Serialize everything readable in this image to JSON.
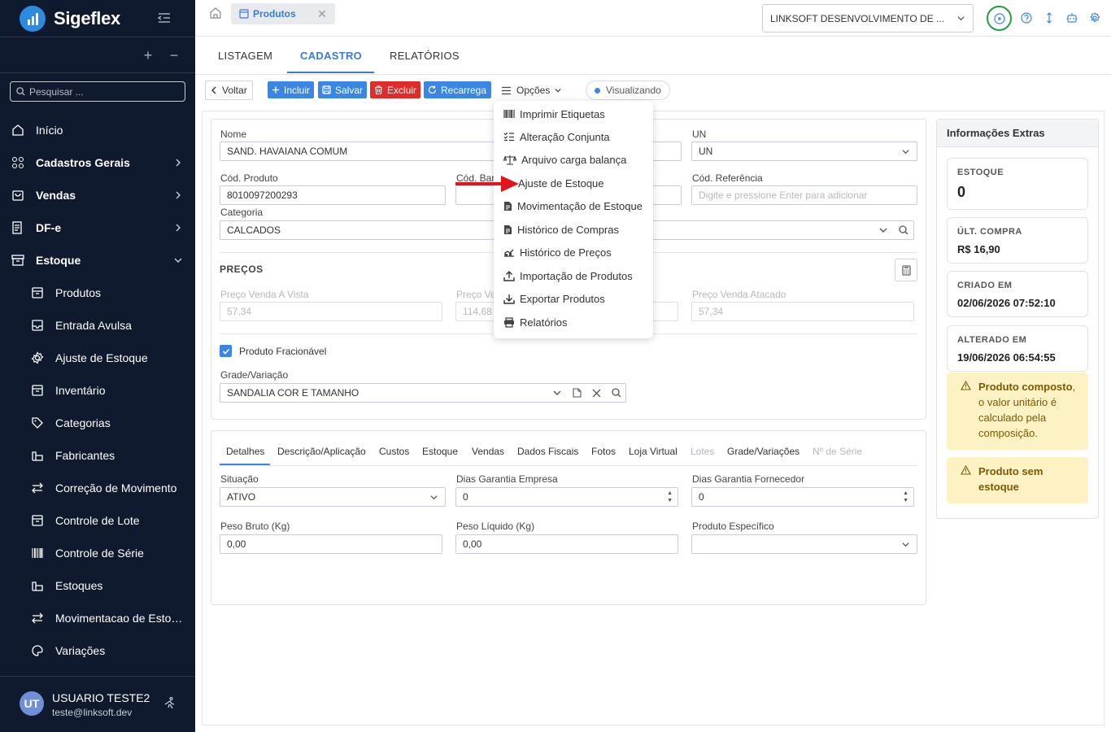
{
  "app": {
    "name": "Sigeflex"
  },
  "sidebar": {
    "search_placeholder": "Pesquisar ...",
    "items": [
      {
        "label": "Início",
        "icon": "home-icon"
      },
      {
        "label": "Cadastros Gerais",
        "icon": "grid-icon"
      },
      {
        "label": "Vendas",
        "icon": "shopping-bag-icon"
      },
      {
        "label": "DF-e",
        "icon": "document-icon"
      },
      {
        "label": "Estoque",
        "icon": "inventory-box-icon"
      }
    ],
    "sub_items": [
      {
        "label": "Produtos",
        "icon": "box-icon"
      },
      {
        "label": "Entrada Avulsa",
        "icon": "inbox-icon"
      },
      {
        "label": "Ajuste de Estoque",
        "icon": "gear-icon"
      },
      {
        "label": "Inventário",
        "icon": "box-icon"
      },
      {
        "label": "Categorias",
        "icon": "tag-icon"
      },
      {
        "label": "Fabricantes",
        "icon": "factory-icon"
      },
      {
        "label": "Correção de Movimento",
        "icon": "swap-icon"
      },
      {
        "label": "Controle de Lote",
        "icon": "box-icon"
      },
      {
        "label": "Controle de Série",
        "icon": "barcode-icon"
      },
      {
        "label": "Estoques",
        "icon": "factory-icon"
      },
      {
        "label": "Movimentacao de Estoque",
        "icon": "swap-icon"
      },
      {
        "label": "Variações",
        "icon": "palette-icon"
      }
    ],
    "user": {
      "initials": "UT",
      "name": "USUARIO TESTE2",
      "email": "teste@linksoft.dev"
    }
  },
  "topbar": {
    "tab_label": "Produtos",
    "company": "LINKSOFT DESENVOLVIMENTO DE ..."
  },
  "subtabs": [
    "LISTAGEM",
    "CADASTRO",
    "RELATÓRIOS"
  ],
  "toolbar": {
    "voltar": "Voltar",
    "incluir": "Incluir",
    "salvar": "Salvar",
    "excluir": "Excluir",
    "recarrega": "Recarrega",
    "opcoes": "Opções",
    "status": "Visualizando"
  },
  "form": {
    "nome_label": "Nome",
    "nome_value": "SAND. HAVAIANA COMUM",
    "un_label": "UN",
    "un_value": "UN",
    "cod_produto_label": "Cód. Produto",
    "cod_produto_value": "8010097200293",
    "cod_barras_label": "Cód. Bar",
    "cod_ref_label": "Cód. Referência",
    "cod_ref_placeholder": "Digite e pressione Enter para adicionar",
    "categoria_label": "Categoria",
    "categoria_value": "CALCADOS",
    "precos_title": "PREÇOS",
    "preco_vista_label": "Preço Venda A Vista",
    "preco_vista_value": "57,34",
    "preco_ve_label": "Preço Ve",
    "preco_ve_value": "114,68",
    "preco_atacado_label": "Preço Venda Atacado",
    "preco_atacado_value": "57,34",
    "fracionavel_label": "Produto Fracionável",
    "fracionavel_checked": true,
    "grade_label": "Grade/Variação",
    "grade_value": "SANDALIA COR E TAMANHO"
  },
  "details": {
    "tabs": [
      {
        "label": "Detalhes",
        "disabled": false
      },
      {
        "label": "Descrição/Aplicação",
        "disabled": false
      },
      {
        "label": "Custos",
        "disabled": false
      },
      {
        "label": "Estoque",
        "disabled": false
      },
      {
        "label": "Vendas",
        "disabled": false
      },
      {
        "label": "Dados Fiscais",
        "disabled": false
      },
      {
        "label": "Fotos",
        "disabled": false
      },
      {
        "label": "Loja Virtual",
        "disabled": false
      },
      {
        "label": "Lotes",
        "disabled": true
      },
      {
        "label": "Grade/Variações",
        "disabled": false
      },
      {
        "label": "Nº de Série",
        "disabled": true
      }
    ],
    "situacao_label": "Situação",
    "situacao_value": "ATIVO",
    "garantia_empresa_label": "Dias Garantia Empresa",
    "garantia_empresa_value": "0",
    "garantia_fornecedor_label": "Dias Garantia Fornecedor",
    "garantia_fornecedor_value": "0",
    "peso_bruto_label": "Peso Bruto (Kg)",
    "peso_bruto_value": "0,00",
    "peso_liquido_label": "Peso Líquido (Kg)",
    "peso_liquido_value": "0,00",
    "produto_especifico_label": "Produto Específico",
    "produto_especifico_value": ""
  },
  "extras": {
    "title": "Informações Extras",
    "estoque_label": "ESTOQUE",
    "estoque_value": "0",
    "ult_compra_label": "ÚLT. COMPRA",
    "ult_compra_value": "R$ 16,90",
    "criado_label": "CRIADO EM",
    "criado_value": "02/06/2026 07:52:10",
    "alterado_label": "ALTERADO EM",
    "alterado_value": "19/06/2026 06:54:55",
    "warn1_bold": "Produto composto",
    "warn1_rest": ", o valor unitário é calculado pela composição.",
    "warn2_bold": "Produto sem estoque"
  },
  "dropdown": {
    "items": [
      {
        "label": "Imprimir Etiquetas",
        "icon": "barcode-icon"
      },
      {
        "label": "Alteração Conjunta",
        "icon": "checklist-icon"
      },
      {
        "label": "Arquivo carga balança",
        "icon": "scale-icon"
      },
      {
        "label": "Ajuste de Estoque",
        "icon": "arrow-right-icon"
      },
      {
        "label": "Movimentação de Estoque",
        "icon": "file-icon"
      },
      {
        "label": "Histórico de Compras",
        "icon": "file-icon"
      },
      {
        "label": "Histórico de Preços",
        "icon": "price-history-icon"
      },
      {
        "label": "Importação de Produtos",
        "icon": "upload-icon"
      },
      {
        "label": "Exportar Produtos",
        "icon": "download-icon"
      },
      {
        "label": "Relatórios",
        "icon": "printer-icon"
      }
    ]
  },
  "colors": {
    "primary": "#3a86e4",
    "danger": "#e02b2b",
    "sidebar": "#0f1a2e",
    "warning_bg": "#fdf2c4"
  }
}
